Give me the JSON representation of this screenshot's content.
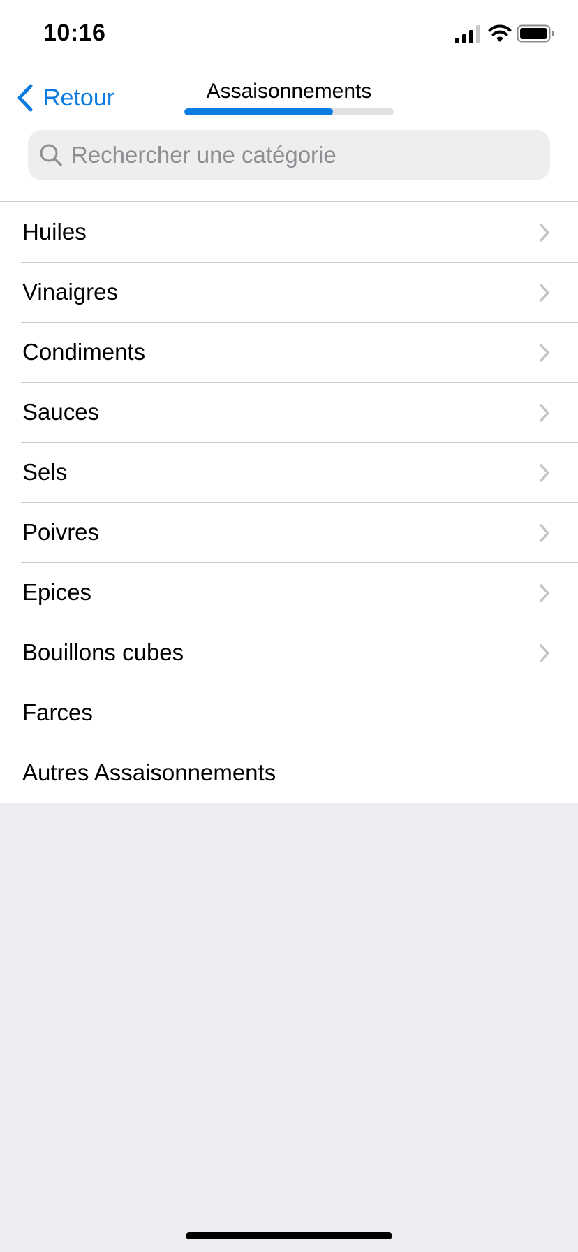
{
  "status_bar": {
    "time": "10:16",
    "icons": [
      "cellular-signal-icon",
      "wifi-icon",
      "battery-icon"
    ]
  },
  "nav": {
    "back_label": "Retour",
    "back_icon": "chevron-left-icon",
    "title": "Assaisonnements",
    "progress": 0.71
  },
  "search": {
    "placeholder": "Rechercher une catégorie",
    "value": "",
    "icon": "search-icon"
  },
  "list": {
    "items": [
      {
        "label": "Huiles",
        "has_chevron": true
      },
      {
        "label": "Vinaigres",
        "has_chevron": true
      },
      {
        "label": "Condiments",
        "has_chevron": true
      },
      {
        "label": "Sauces",
        "has_chevron": true
      },
      {
        "label": "Sels",
        "has_chevron": true
      },
      {
        "label": "Poivres",
        "has_chevron": true
      },
      {
        "label": "Epices",
        "has_chevron": true
      },
      {
        "label": "Bouillons cubes",
        "has_chevron": true
      },
      {
        "label": "Farces",
        "has_chevron": false
      },
      {
        "label": "Autres Assaisonnements",
        "has_chevron": false
      }
    ]
  },
  "colors": {
    "accent": "#0A7BE0",
    "background": "#EDEDF2",
    "separator": "#C8C7CC",
    "chevron": "#C4C4C7"
  }
}
